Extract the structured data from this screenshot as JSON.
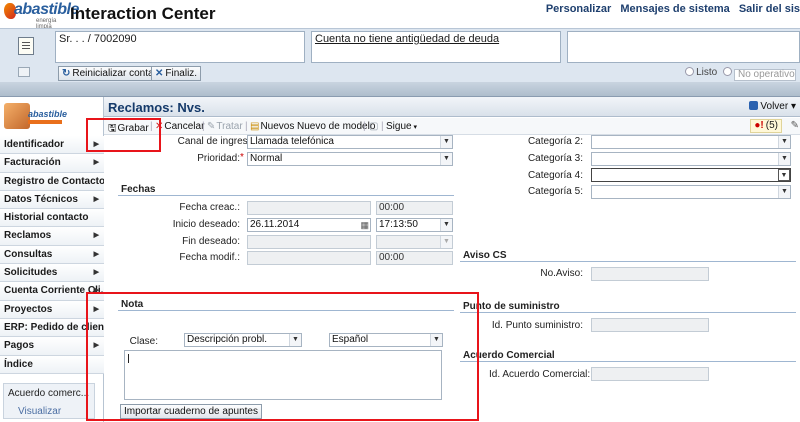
{
  "header": {
    "logo_text": "abastible",
    "logo_subtext": "energía limpia",
    "app_title": "Interaction Center",
    "links": [
      "Personalizar",
      "Mensajes de sistema",
      "Salir del sis"
    ]
  },
  "context": {
    "customer": "Sr. . . / 7002090",
    "debt_status": "Cuenta no tiene antigüedad de deuda",
    "reset_button": "Reinicializar contacto",
    "finish_button": "Finaliz.",
    "status_ready": "Listo",
    "status_not_operating": "No operativo"
  },
  "sidebar": {
    "items": [
      {
        "label": "Identificador",
        "arrow": true
      },
      {
        "label": "Facturación",
        "arrow": true
      },
      {
        "label": "Registro de Contacto",
        "arrow": false
      },
      {
        "label": "Datos Técnicos",
        "arrow": true
      },
      {
        "label": "Historial contacto",
        "arrow": false
      },
      {
        "label": "Reclamos",
        "arrow": true
      },
      {
        "label": "Consultas",
        "arrow": true
      },
      {
        "label": "Solicitudes",
        "arrow": true
      },
      {
        "label": "Cuenta Corriente Cli...",
        "arrow": true
      },
      {
        "label": "Proyectos",
        "arrow": true
      },
      {
        "label": "ERP: Pedido de cliente",
        "arrow": false
      },
      {
        "label": "Pagos",
        "arrow": true
      },
      {
        "label": "Índice",
        "arrow": false
      }
    ],
    "box_title": "Acuerdo comerc...",
    "box_link": "Visualizar"
  },
  "main": {
    "title": "Reclamos: Nvs.",
    "back_label": "Volver",
    "toolbar": {
      "save": "Grabar",
      "cancel": "Cancelar",
      "process": "Tratar",
      "new": "Nuevos",
      "new_from_template": "Nuevo de modelo",
      "next": "Sigue",
      "message_count": "(5)"
    },
    "form": {
      "channel_label": "Canal de ingreso:",
      "channel_value": "Llamada telefónica",
      "priority_label": "Prioridad:",
      "priority_required": "*",
      "priority_value": "Normal",
      "dates_section": "Fechas",
      "created_label": "Fecha creac.:",
      "created_time": "00:00",
      "start_label": "Inicio deseado:",
      "start_date": "26.11.2014",
      "start_time": "17:13:50",
      "end_label": "Fin deseado:",
      "modified_label": "Fecha modif.:",
      "modified_time": "00:00",
      "note_section": "Nota",
      "class_label": "Clase:",
      "class_value": "Descripción probl.",
      "language_value": "Español",
      "import_button": "Importar cuaderno de apuntes",
      "cat2_label": "Categoría 2:",
      "cat3_label": "Categoría 3:",
      "cat4_label": "Categoría 4:",
      "cat5_label": "Categoría 5:",
      "notice_section": "Aviso CS",
      "notice_label": "No.Aviso:",
      "supply_section": "Punto de suministro",
      "supply_label": "Id. Punto suministro:",
      "agreement_section": "Acuerdo Comercial",
      "agreement_label": "Id. Acuerdo Comercial:"
    }
  },
  "colors": {
    "highlight": "#e8141a",
    "title_blue": "#153a6a",
    "context_bg": "#dde6f0"
  }
}
